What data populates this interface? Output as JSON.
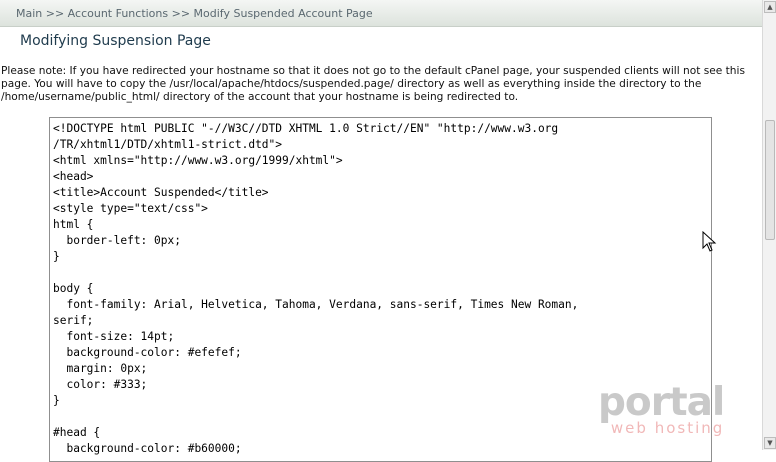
{
  "breadcrumb": "Main >> Account Functions >> Modify Suspended Account Page",
  "title": "Modifying Suspension Page",
  "note": "Please note: If you have redirected your hostname so that it does not go to the default cPanel page, your suspended clients will not see this page. You will have to copy the /usr/local/apache/htdocs/suspended.page/ directory as well as everything inside the directory to the /home/username/public_html/ directory of the account that your hostname is being redirected to.",
  "code_lines": [
    "<!DOCTYPE html PUBLIC \"-//W3C//DTD XHTML 1.0 Strict//EN\" \"http://www.w3.org",
    "/TR/xhtml1/DTD/xhtml1-strict.dtd\">",
    "<html xmlns=\"http://www.w3.org/1999/xhtml\">",
    "<head>",
    "<title>Account Suspended</title>",
    "<style type=\"text/css\">",
    "html {",
    "  border-left: 0px;",
    "}",
    "",
    "body {",
    "  font-family: Arial, Helvetica, Tahoma, Verdana, sans-serif, Times New Roman,",
    "serif;",
    "  font-size: 14pt;",
    "  background-color: #efefef;",
    "  margin: 0px;",
    "  color: #333;",
    "}",
    "",
    "#head {",
    "  background-color: #b60000;"
  ],
  "watermark": {
    "main": "portal",
    "sub": "web hosting"
  },
  "icons": {
    "cursor": "mouse-pointer-icon",
    "scroll_up": "triangle-up-icon",
    "scroll_down": "triangle-down-icon"
  }
}
